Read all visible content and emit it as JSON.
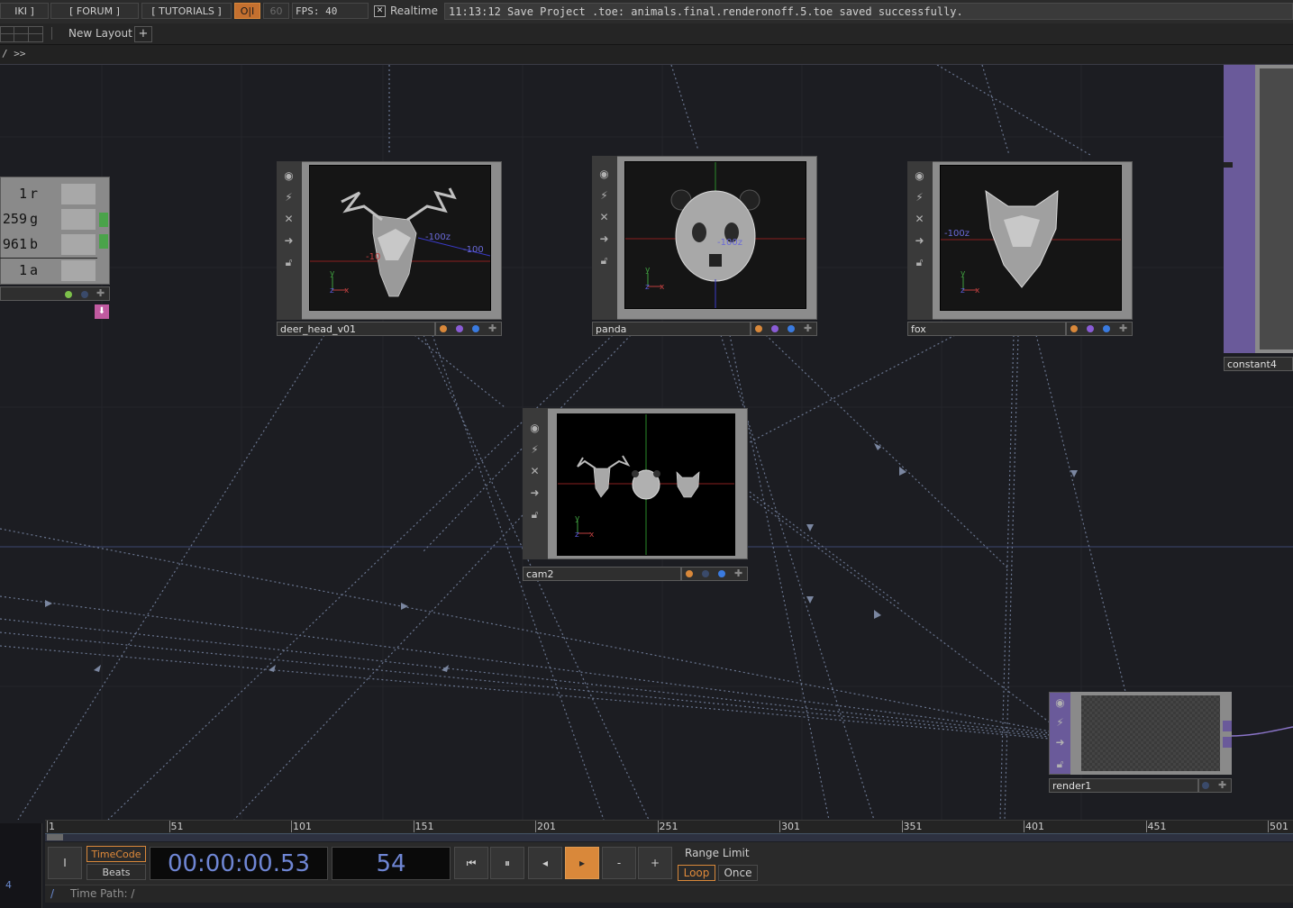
{
  "topbar": {
    "wiki_label": "IKI ]",
    "forum_label": "[ FORUM ]",
    "tutorials_label": "[ TUTORIALS ]",
    "oi_label": "O|I",
    "fps_cap": "60",
    "fps_label": "FPS:  40",
    "realtime_label": "Realtime",
    "status_message": "11:13:12 Save Project .toe: animals.final.renderonoff.5.toe saved successfully."
  },
  "layoutbar": {
    "new_layout_label": "New Layout",
    "add_label": "+"
  },
  "pathbar": {
    "path_label": "/  >>"
  },
  "nodes": {
    "deer": {
      "name": "deer_head_v01",
      "axis_z": "-100z",
      "axis_neg": "-100",
      "axis_100": "-10"
    },
    "panda": {
      "name": "panda",
      "axis_z": "-100z"
    },
    "fox": {
      "name": "fox",
      "axis_z": "-100z"
    },
    "cam": {
      "name": "cam2"
    },
    "render": {
      "name": "render1"
    },
    "constant": {
      "name": "constant4"
    },
    "channels": {
      "rows": [
        {
          "value": "1",
          "name": "r"
        },
        {
          "value": "259",
          "name": "g"
        },
        {
          "value": "961",
          "name": "b"
        },
        {
          "value": "1",
          "name": "a"
        }
      ]
    },
    "axis_labels": {
      "y": "y",
      "z": "z",
      "x": "x"
    }
  },
  "timeline": {
    "ticks": [
      "1",
      "51",
      "101",
      "151",
      "201",
      "251",
      "301",
      "351",
      "401",
      "451",
      "501"
    ],
    "left_mini_value": "4"
  },
  "transport": {
    "timecode_label": "TimeCode",
    "beats_label": "Beats",
    "time_display": "00:00:00.53",
    "frame_display": "54",
    "range_limit_label": "Range Limit",
    "loop_label": "Loop",
    "once_label": "Once",
    "i_label": "I",
    "minus_label": "-",
    "plus_label": "+"
  },
  "timepath": {
    "slash": "/",
    "label": "Time Path: /"
  },
  "colors": {
    "accent_orange": "#d9883a",
    "flag_purple": "#8a5cd6",
    "flag_blue": "#3a7be0",
    "node_purple": "#6a5a9a"
  }
}
